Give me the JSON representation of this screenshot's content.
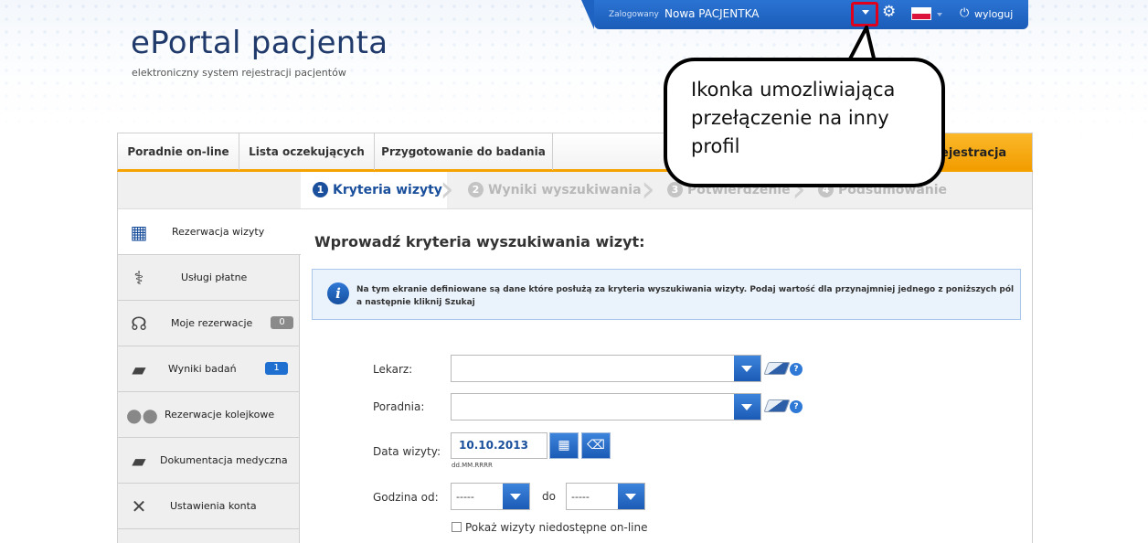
{
  "topbar": {
    "logged_label": "Zalogowany",
    "user_name": "Nowa PACJENTKA",
    "logout_label": "wyloguj",
    "highlight_color": "#e0001b"
  },
  "logo": {
    "title": "ePortal pacjenta",
    "subtitle": "elektroniczny system rejestracji pacjentów"
  },
  "nav": {
    "tabs": [
      {
        "label": "Poradnie on-line"
      },
      {
        "label": "Lista oczekujących"
      },
      {
        "label": "Przygotowanie do badania"
      }
    ],
    "orange_tab": "Rejestracja"
  },
  "steps": [
    {
      "num": "1",
      "label": "Kryteria wizyty"
    },
    {
      "num": "2",
      "label": "Wyniki wyszukiwania"
    },
    {
      "num": "3",
      "label": "Potwierdzenie"
    },
    {
      "num": "4",
      "label": "Podsumowanie"
    }
  ],
  "sidebar": {
    "items": [
      {
        "label": "Rezerwacja wizyty",
        "icon": "calendar-icon"
      },
      {
        "label": "Usługi płatne",
        "icon": "stethoscope-tag-icon"
      },
      {
        "label": "Moje rezerwacje",
        "icon": "stethoscope-icon",
        "badge": "0"
      },
      {
        "label": "Wyniki badań",
        "icon": "folder-icon",
        "badge": "1"
      },
      {
        "label": "Rezerwacje kolejkowe",
        "icon": "people-icon"
      },
      {
        "label": "Dokumentacja medyczna",
        "icon": "folder-icon"
      },
      {
        "label": "Ustawienia konta",
        "icon": "tools-icon"
      }
    ]
  },
  "content": {
    "title": "Wprowadź kryteria wyszukiwania wizyt:",
    "info": "Na tym ekranie definiowane są dane które posłużą za kryteria wyszukiwania wizyty. Podaj wartość dla przynajmniej jednego z poniższych pól a następnie kliknij Szukaj",
    "lekarz_label": "Lekarz:",
    "lekarz_value": "",
    "poradnia_label": "Poradnia:",
    "poradnia_value": "",
    "data_label": "Data wizyty:",
    "data_value": "10.10.2013",
    "data_hint": "dd.MM.RRRR",
    "godzina_label": "Godzina od:",
    "godzina_od_value": "-----",
    "do_label": "do",
    "godzina_do_value": "-----",
    "checkbox_label": "Pokaż wizyty niedostępne on-line"
  },
  "callout": {
    "text": "Ikonka umozliwiająca przełączenie na inny profil"
  }
}
